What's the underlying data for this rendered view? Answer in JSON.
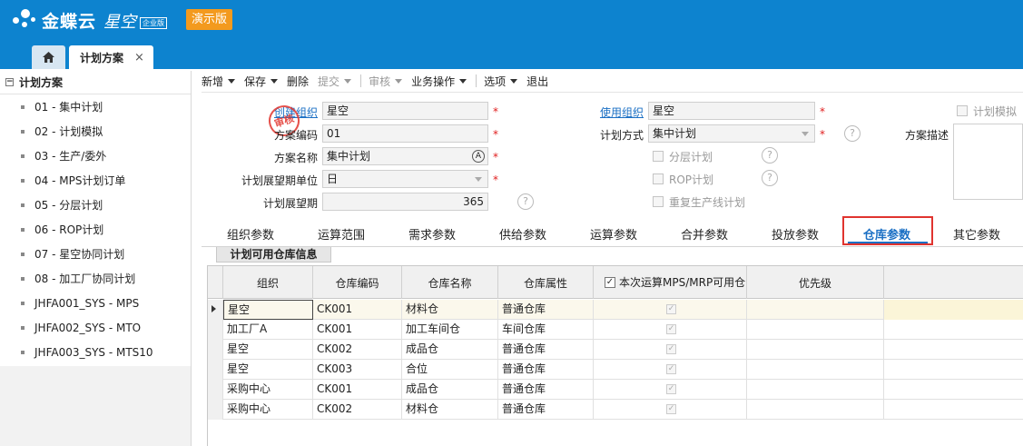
{
  "app": {
    "brand": "金蝶云",
    "product": "星空",
    "edition": "企业版",
    "demo_badge": "演示版"
  },
  "tabs": {
    "home_icon": "home-icon",
    "current": "计划方案",
    "close_symbol": "×"
  },
  "sidebar": {
    "root": "计划方案",
    "items": [
      "01 - 集中计划",
      "02 - 计划模拟",
      "03 - 生产/委外",
      "04 - MPS计划订单",
      "05 - 分层计划",
      "06 - ROP计划",
      "07 - 星空协同计划",
      "08 - 加工厂协同计划",
      "JHFA001_SYS - MPS",
      "JHFA002_SYS - MTO",
      "JHFA003_SYS - MTS10"
    ]
  },
  "toolbar": {
    "new": "新增",
    "save": "保存",
    "delete": "删除",
    "submit": "提交",
    "audit": "审核",
    "business": "业务操作",
    "options": "选项",
    "exit": "退出"
  },
  "form": {
    "create_org_label": "创建组织",
    "create_org_value": "星空",
    "code_label": "方案编码",
    "code_value": "01",
    "name_label": "方案名称",
    "name_value": "集中计划",
    "unit_label": "计划展望期单位",
    "unit_value": "日",
    "period_label": "计划展望期",
    "period_value": "365",
    "use_org_label": "使用组织",
    "use_org_value": "星空",
    "method_label": "计划方式",
    "method_value": "集中计划",
    "layered_label": "分层计划",
    "rop_label": "ROP计划",
    "repeat_label": "重复生产线计划",
    "simulate_label": "计划模拟",
    "desc_label": "方案描述",
    "required_mark": "*",
    "help_symbol": "?",
    "stamp_text": "审核"
  },
  "page_tabs": [
    "组织参数",
    "运算范围",
    "需求参数",
    "供给参数",
    "运算参数",
    "合并参数",
    "投放参数",
    "仓库参数",
    "其它参数"
  ],
  "active_tab": "仓库参数",
  "subtab": "计划可用仓库信息",
  "grid": {
    "headers": [
      "组织",
      "仓库编码",
      "仓库名称",
      "仓库属性",
      "本次运算MPS/MRP可用仓",
      "优先级"
    ],
    "rows": [
      {
        "org": "星空",
        "code": "CK001",
        "name": "材料仓",
        "attr": "普通仓库",
        "checked": true
      },
      {
        "org": "加工厂A",
        "code": "CK001",
        "name": "加工车间仓",
        "attr": "车间仓库",
        "checked": true
      },
      {
        "org": "星空",
        "code": "CK002",
        "name": "成品仓",
        "attr": "普通仓库",
        "checked": true
      },
      {
        "org": "星空",
        "code": "CK003",
        "name": "合位",
        "attr": "普通仓库",
        "checked": true
      },
      {
        "org": "采购中心",
        "code": "CK001",
        "name": "成品仓",
        "attr": "普通仓库",
        "checked": true
      },
      {
        "org": "采购中心",
        "code": "CK002",
        "name": "材料仓",
        "attr": "普通仓库",
        "checked": true
      }
    ]
  }
}
